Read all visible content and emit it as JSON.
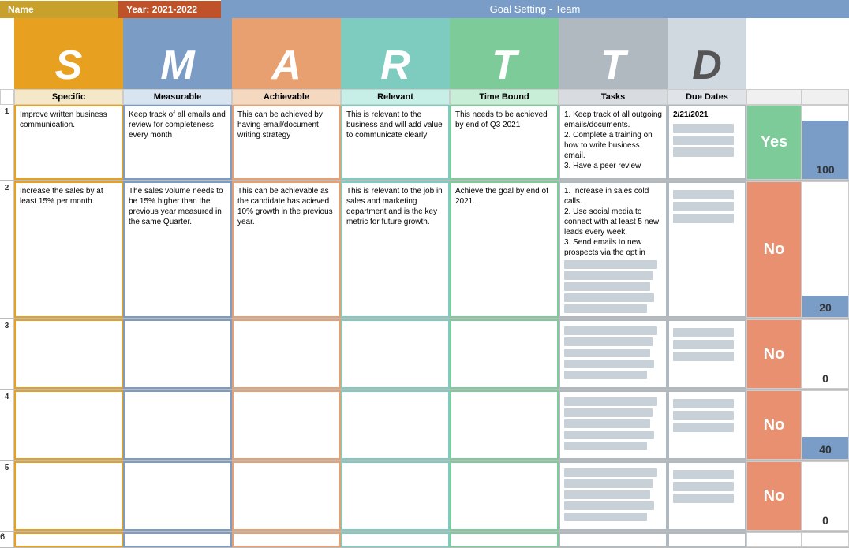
{
  "header": {
    "name_label": "Name",
    "year_label": "Year:",
    "year_value": "2021-2022",
    "title": "Goal Setting - Team"
  },
  "columns": {
    "s_letter": "S",
    "m_letter": "M",
    "a_letter": "A",
    "r_letter": "R",
    "t1_letter": "T",
    "t2_letter": "T",
    "d_letter": "D",
    "specific_label": "Specific",
    "measurable_label": "Measurable",
    "achievable_label": "Achievable",
    "relevant_label": "Relevant",
    "timebound_label": "Time Bound",
    "tasks_label": "Tasks",
    "duedates_label": "Due Dates"
  },
  "rows": [
    {
      "num": "1",
      "specific": "Improve written business communication.",
      "measurable": "Keep track of all emails and review for completeness every month",
      "achievable": "This can be achieved by having email/document writing strategy",
      "relevant": "This is relevant to the business and will add value to communicate clearly",
      "timebound": "This needs to be achieved by end of Q3 2021",
      "tasks": "1. Keep track of all outgoing emails/documents.\n2. Complete a training on how to write business email.\n3. Have a peer review",
      "duedate": "2/21/2021",
      "yesno": "Yes",
      "score": 100,
      "score_height": 80
    },
    {
      "num": "2",
      "specific": "Increase the sales by at least 15% per month.",
      "measurable": "The sales volume needs to be 15% higher than the previous year measured in the same Quarter.",
      "achievable": "This can be achievable as the candidate has acieved 10% growth in the previous year.",
      "relevant": "This is relevant to the job in sales and marketing department and is the key metric for future growth.",
      "timebound": "Achieve the goal by end of 2021.",
      "tasks": "1. Increase in sales cold calls.\n2. Use social media to connect with at least 5 new leads every week.\n3. Send emails to new prospects via the opt in",
      "duedate": "",
      "yesno": "No",
      "score": 20,
      "score_height": 16
    },
    {
      "num": "3",
      "specific": "",
      "measurable": "",
      "achievable": "",
      "relevant": "",
      "timebound": "",
      "tasks": "",
      "duedate": "",
      "yesno": "No",
      "score": 0,
      "score_height": 0
    },
    {
      "num": "4",
      "specific": "",
      "measurable": "",
      "achievable": "",
      "relevant": "",
      "timebound": "",
      "tasks": "",
      "duedate": "",
      "yesno": "No",
      "score": 40,
      "score_height": 32
    },
    {
      "num": "5",
      "specific": "",
      "measurable": "",
      "achievable": "",
      "relevant": "",
      "timebound": "",
      "tasks": "",
      "duedate": "",
      "yesno": "No",
      "score": 0,
      "score_height": 0
    }
  ]
}
